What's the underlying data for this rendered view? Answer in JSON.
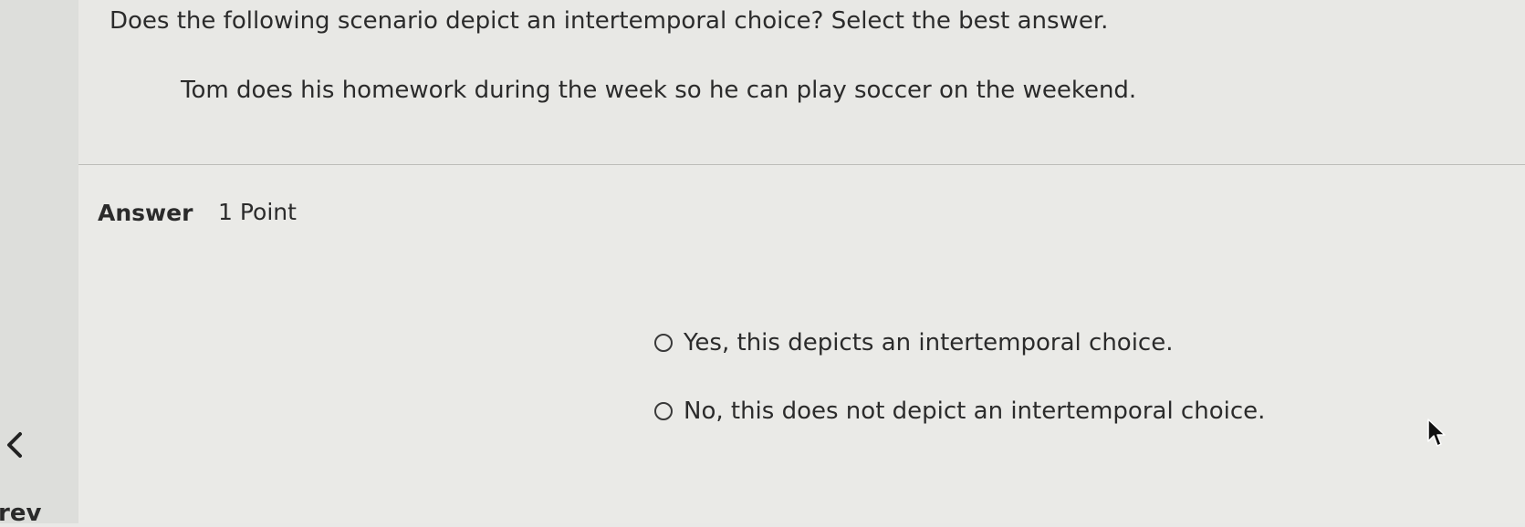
{
  "nav": {
    "prev_label": "rev"
  },
  "question": {
    "prompt": "Does the following scenario depict an intertemporal choice? Select the best answer.",
    "scenario": "Tom does his homework during the week so he can play soccer on the weekend."
  },
  "answer": {
    "heading": "Answer",
    "points": "1 Point",
    "options": [
      {
        "label": "Yes, this depicts an intertemporal choice.",
        "selected": false
      },
      {
        "label": "No, this does not depict an intertemporal choice.",
        "selected": false
      }
    ]
  },
  "icons": {
    "prev": "chevron-left-icon",
    "cursor": "mouse-pointer-icon",
    "radio": "radio-unchecked-icon"
  }
}
